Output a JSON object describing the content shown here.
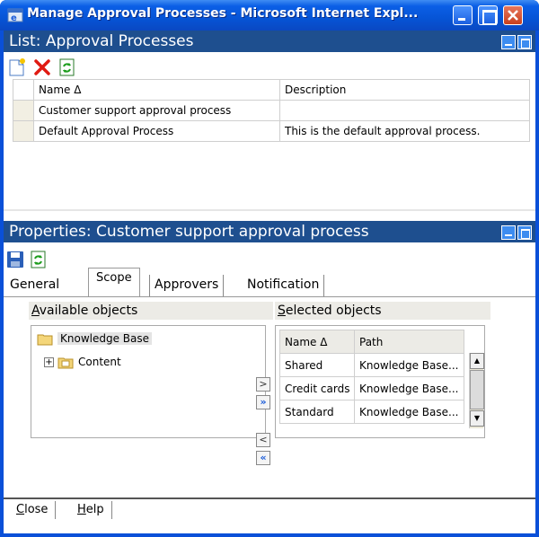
{
  "window": {
    "title": "Manage Approval Processes - Microsoft Internet Expl..."
  },
  "list_panel": {
    "header": "List: Approval Processes",
    "toolbar": [
      "new-icon",
      "delete-icon",
      "refresh-icon"
    ],
    "columns": [
      "Name Δ",
      "Description"
    ],
    "rows": [
      {
        "name": "Customer support approval process",
        "description": ""
      },
      {
        "name": "Default Approval Process",
        "description": "This is the default approval process."
      }
    ]
  },
  "properties_panel": {
    "header": "Properties: Customer support approval process",
    "toolbar": [
      "save-icon",
      "refresh-icon"
    ],
    "tabs": {
      "general": "General",
      "scope": "Scope",
      "approvers": "Approvers",
      "notification": "Notification",
      "active": "Scope"
    },
    "available": {
      "label_underline": "A",
      "label_rest": "vailable objects",
      "tree": [
        {
          "label": "Knowledge Base",
          "selected": true
        },
        {
          "label": "Content",
          "expandable": true
        }
      ]
    },
    "move_buttons": [
      ">",
      "»",
      "<",
      "«"
    ],
    "selected": {
      "label_underline": "S",
      "label_rest": "elected objects",
      "columns": [
        "Name Δ",
        "Path"
      ],
      "rows": [
        {
          "name": "Shared",
          "path": "Knowledge Base..."
        },
        {
          "name": "Credit cards",
          "path": "Knowledge Base..."
        },
        {
          "name": "Standard",
          "path": "Knowledge Base..."
        }
      ]
    }
  },
  "footer": {
    "close_underline": "C",
    "close_rest": "lose",
    "help_underline": "H",
    "help_rest": "elp"
  },
  "colors": {
    "panel_header": "#1e4f8f",
    "titlebar": "#0654d6",
    "accent": "#3d8cf0"
  }
}
